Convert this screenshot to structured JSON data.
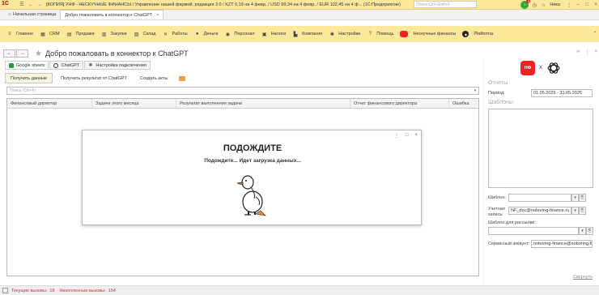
{
  "titlebar": {
    "logo": "1С",
    "title": "[КОПИЯ] УНФ - НЕСКУЧНЫЕ ФИНАНСЫ / Управление нашей фирмой, редакция 3.0 / KZT 0,19 на 4 февр. / USD 99,34 на 4 февр. / EUR 102,45 на 4 ф... (1С:Предприятие)",
    "search_placeholder": "Поиск Ctrl+Shift+F",
    "notif_count": "5",
    "user": "Ника"
  },
  "tabs": [
    {
      "label": "Начальная страница"
    },
    {
      "label": "Добро пожаловать в коннектор к ChatGPT"
    }
  ],
  "menu": [
    "Главное",
    "CRM",
    "Продажи",
    "Закупки",
    "Склад",
    "Работы",
    "Деньги",
    "Персонал",
    "Налоги",
    "Компания",
    "Настройки",
    "Помощь",
    "Нескучные финансы",
    "Platforma"
  ],
  "page": {
    "title": "Добро пожаловать в коннектор к ChatGPT"
  },
  "subtabs": [
    "Google sheets",
    "ChatGPT",
    "Настройка подключения"
  ],
  "commands": [
    "Получить данные",
    "Получить результат от ChatGPT",
    "Создать акты"
  ],
  "search": {
    "placeholder": "Поиск (Ctrl+F)"
  },
  "table": {
    "columns": [
      "Финансовый директор",
      "Задачи этого месяца",
      "Результат выполнения задачи",
      "Отчет финансового директора",
      "Ошибка"
    ]
  },
  "modal": {
    "title": "ПОДОЖДИТЕ",
    "subtitle": "Подождите... Идет загрузка данных..."
  },
  "side": {
    "x": "X",
    "reports_heading": "Отчеты",
    "period_label": "Период:",
    "period_value": "01.05.2025 - 31.05.2025",
    "templates_heading": "Шаблоны",
    "template_label": "Шаблон:",
    "template_value": "",
    "account_label": "Учетная запись:",
    "account_value": "NF_doc@noboring-finance.ru",
    "mailing_label": "Шаблон для рассылки:",
    "mailing_value": "",
    "service_label": "Сервисный аккаунт:",
    "service_value": "noboring-finance@noboring-fi",
    "collapse": "Свернуть"
  },
  "status": {
    "current_label": "Текущие вызовы:",
    "current_value": "18",
    "accum_label": "Накопленные вызовы:",
    "accum_value": "154"
  },
  "colors": {
    "accent": "#fbe89a",
    "brand_red": "#e22222"
  }
}
